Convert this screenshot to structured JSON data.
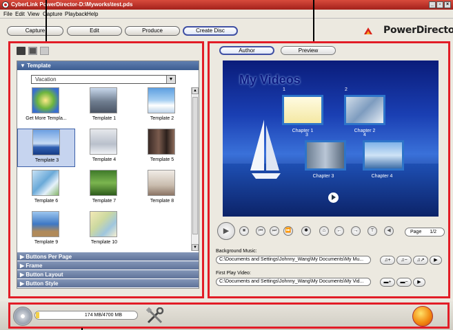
{
  "window": {
    "title": "CyberLink PowerDirector-D:\\Myworks\\test.pds",
    "buttons": {
      "minimize": "_",
      "restore": "▫",
      "close": "×"
    }
  },
  "menu": [
    "File",
    "Edit",
    "View",
    "Capture",
    "Playback",
    "Help"
  ],
  "toolbar": {
    "tabs": [
      "Capture",
      "Edit",
      "Produce",
      "Create Disc"
    ],
    "active_tab": "Create Disc",
    "brand": "PowerDirector"
  },
  "template_panel": {
    "header": "▼ Template",
    "category": "Vacation",
    "templates": [
      "Get More Templa...",
      "Template 1",
      "Template 2",
      "Template 3",
      "Template 4",
      "Template 5",
      "Template 6",
      "Template 7",
      "Template 8",
      "Template 9",
      "Template 10"
    ],
    "selected": "Template 3",
    "sections": [
      "▶ Buttons Per Page",
      "▶ Frame",
      "▶ Button Layout",
      "▶ Button Style"
    ]
  },
  "preview_panel": {
    "tabs": [
      "Author",
      "Preview"
    ],
    "menu_title": "My Videos",
    "chapters": [
      {
        "num": "1",
        "label": "Chapter 1"
      },
      {
        "num": "2",
        "label": "Chapter 2"
      },
      {
        "num": "3",
        "label": "Chapter 3"
      },
      {
        "num": "4",
        "label": "Chapter 4"
      }
    ],
    "page_label": "Page",
    "page_value": "1/2",
    "background_music_label": "Background Music:",
    "background_music_path": "C:\\Documents and Settings\\Johnny_Wang\\My Documents\\My Mu...",
    "first_play_label": "First Play Video:",
    "first_play_path": "C:\\Documents and Settings\\Johnny_Wang\\My Documents\\My Vid..."
  },
  "status": {
    "capacity": "174 MB/4700 MB",
    "capacity_fraction": 0.037
  },
  "colors": {
    "highlight": "#e21c26",
    "accent": "#3f4fa3"
  }
}
